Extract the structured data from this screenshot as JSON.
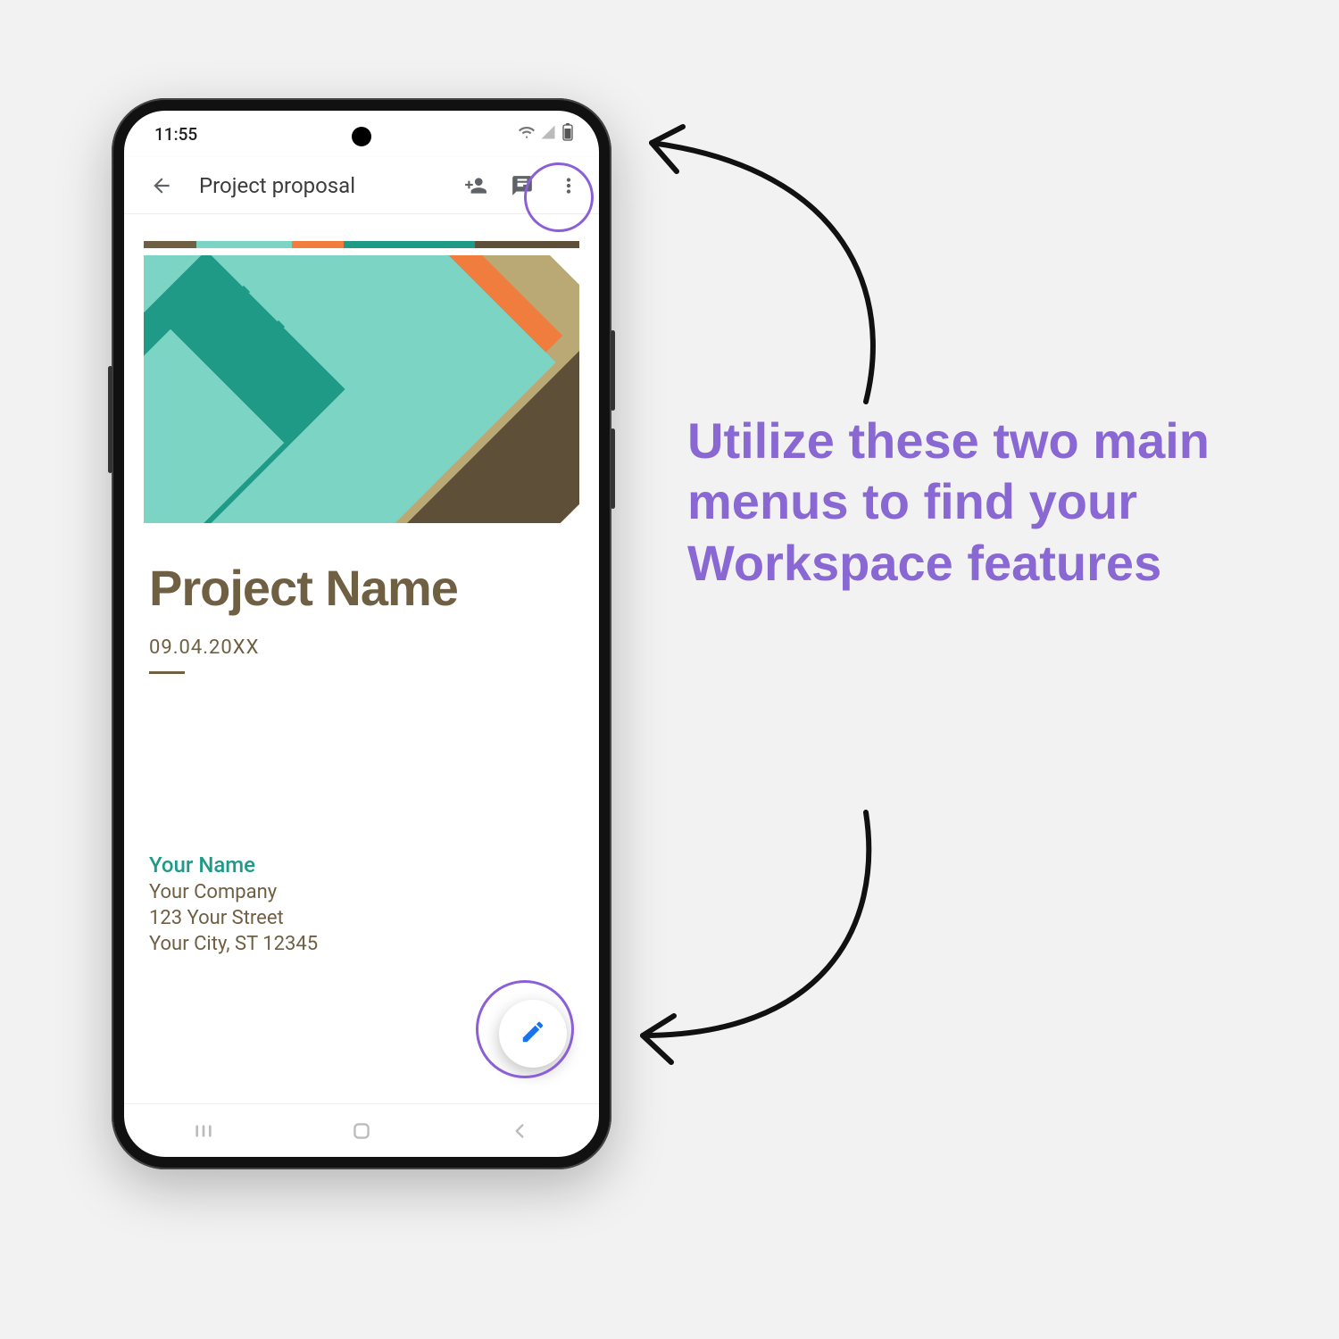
{
  "statusBar": {
    "time": "11:55"
  },
  "appBar": {
    "title": "Project proposal"
  },
  "document": {
    "title": "Project Name",
    "date": "09.04.20XX",
    "footer": {
      "name": "Your Name",
      "company": "Your Company",
      "street": "123 Your Street",
      "city": "Your City, ST 12345"
    }
  },
  "annotation": {
    "text": "Utilize these two main menus to find your Workspace features"
  },
  "colors": {
    "accent": "#8a68d4",
    "highlight": "#8a5fd8",
    "fabIcon": "#1a73e8",
    "docBrown": "#6f5f43",
    "docTeal": "#1f9a86"
  }
}
